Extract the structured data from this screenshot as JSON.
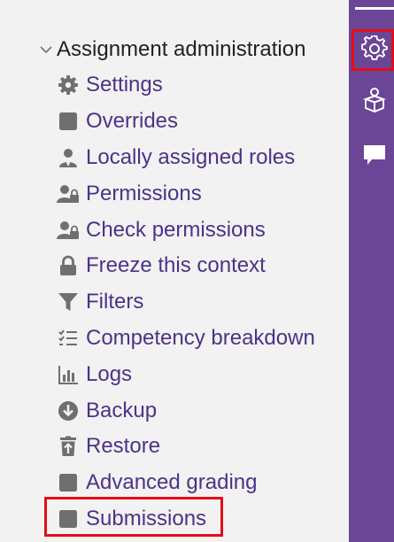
{
  "tree": {
    "header": "Assignment administration",
    "items": [
      {
        "label": "Settings",
        "icon": "gear-icon"
      },
      {
        "label": "Overrides",
        "icon": "square-icon"
      },
      {
        "label": "Locally assigned roles",
        "icon": "user-icon"
      },
      {
        "label": "Permissions",
        "icon": "user-lock-icon"
      },
      {
        "label": "Check permissions",
        "icon": "user-lock-icon"
      },
      {
        "label": "Freeze this context",
        "icon": "lock-icon"
      },
      {
        "label": "Filters",
        "icon": "filter-icon"
      },
      {
        "label": "Competency breakdown",
        "icon": "checklist-icon"
      },
      {
        "label": "Logs",
        "icon": "bar-chart-icon"
      },
      {
        "label": "Backup",
        "icon": "download-circle-icon"
      },
      {
        "label": "Restore",
        "icon": "trash-upload-icon"
      },
      {
        "label": "Advanced grading",
        "icon": "square-icon"
      },
      {
        "label": "Submissions",
        "icon": "square-icon"
      }
    ]
  },
  "drawer": {
    "buttons": [
      "gear-icon",
      "cube-person-icon",
      "chat-bubble-icon"
    ]
  },
  "colors": {
    "panel_bg": "#f2f2f2",
    "link": "#4c3387",
    "icon": "#6f6f6f",
    "drawer_bg": "#6b4596",
    "highlight": "#e20e17"
  }
}
